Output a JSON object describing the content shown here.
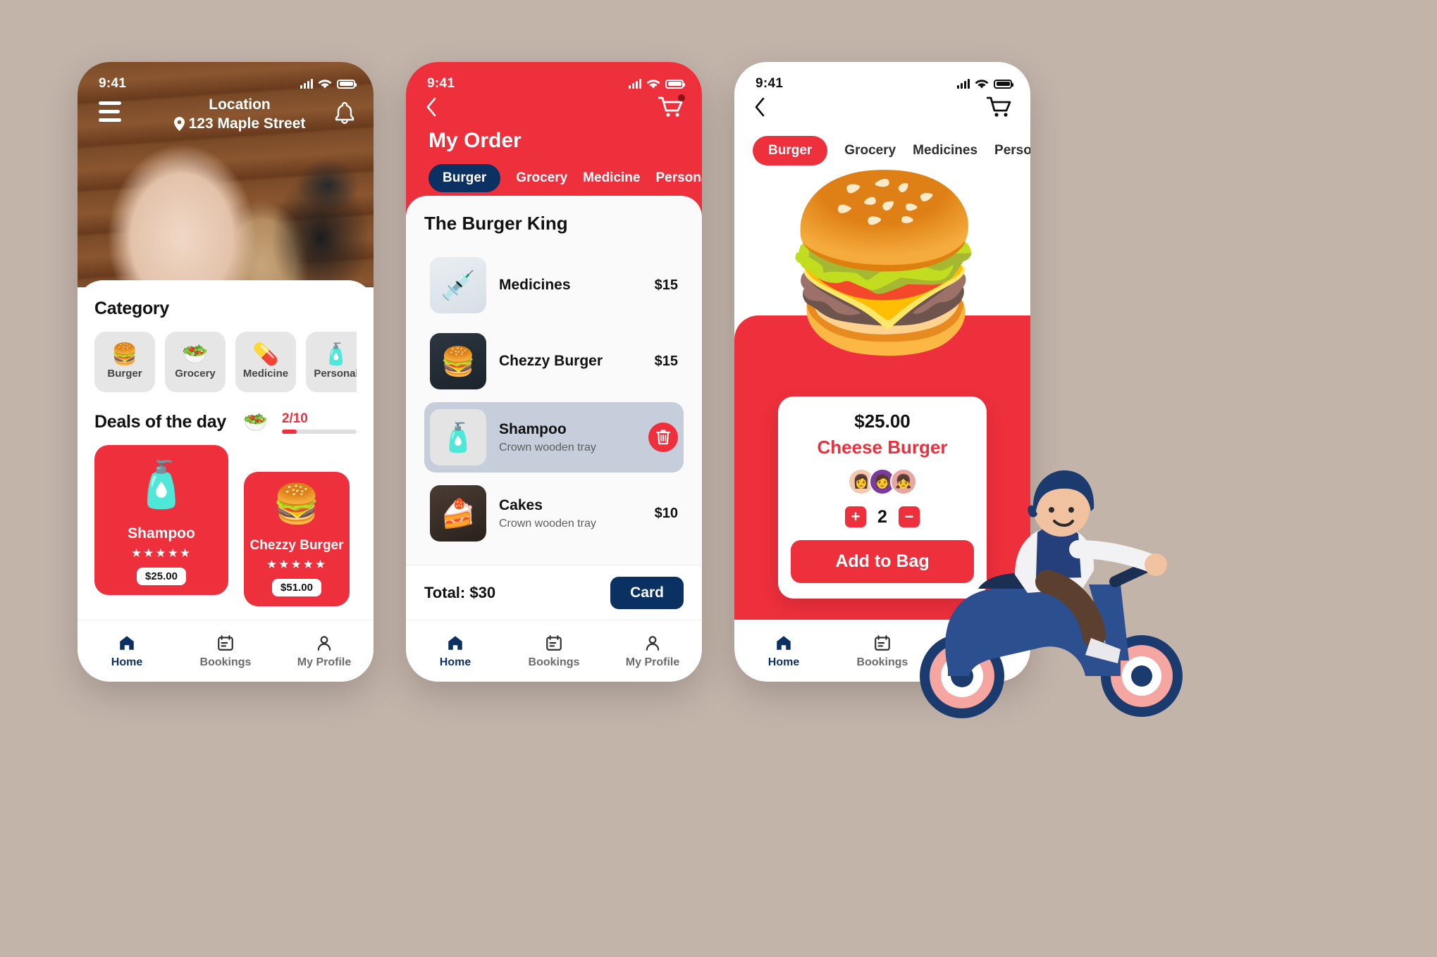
{
  "theme": {
    "brand_red": "#ee2f3c",
    "navy": "#0a3161",
    "bg": "#c3b4aa"
  },
  "phone1": {
    "status": {
      "time": "9:41"
    },
    "header": {
      "menu_icon": "hamburger-icon",
      "location_label": "Location",
      "location_address": "123 Maple Street",
      "pin_icon": "map-pin-icon",
      "bell_icon": "bell-icon"
    },
    "category": {
      "title": "Category",
      "items": [
        {
          "label": "Burger",
          "emoji": "🍔"
        },
        {
          "label": "Grocery",
          "emoji": "🥗"
        },
        {
          "label": "Medicine",
          "emoji": "💊"
        },
        {
          "label": "Personal",
          "emoji": "🧴"
        }
      ]
    },
    "deals": {
      "title": "Deals of the day",
      "emoji": "🥗",
      "counter_current": "2",
      "counter_total": "/10",
      "progress_percent": 20,
      "cards": [
        {
          "name": "Shampoo",
          "emoji": "🧴",
          "stars": "★★★★★",
          "price": "$25.00"
        },
        {
          "name": "Chezzy Burger",
          "emoji": "🍔",
          "stars": "★★★★★",
          "price": "$51.00"
        }
      ]
    },
    "tabbar": [
      {
        "label": "Home",
        "icon": "home-icon",
        "active": true
      },
      {
        "label": "Bookings",
        "icon": "calendar-icon",
        "active": false
      },
      {
        "label": "My Profile",
        "icon": "person-icon",
        "active": false
      }
    ]
  },
  "phone2": {
    "status": {
      "time": "9:41"
    },
    "nav": {
      "back_icon": "chevron-left-icon",
      "cart_icon": "shopping-cart-icon",
      "badge": true
    },
    "title": "My Order",
    "chips": [
      {
        "label": "Burger",
        "selected": true
      },
      {
        "label": "Grocery",
        "selected": false
      },
      {
        "label": "Medicine",
        "selected": false
      },
      {
        "label": "Personal Care",
        "selected": false
      }
    ],
    "shop_title": "The Burger King",
    "items": [
      {
        "name": "Medicines",
        "sub": "",
        "price": "$15",
        "emoji": "💉",
        "selected": false
      },
      {
        "name": "Chezzy Burger",
        "sub": "",
        "price": "$15",
        "emoji": "🍔",
        "selected": false
      },
      {
        "name": "Shampoo",
        "sub": "Crown wooden tray",
        "price": "",
        "emoji": "🧴",
        "selected": true,
        "delete_icon": "trash-icon"
      },
      {
        "name": "Cakes",
        "sub": "Crown wooden tray",
        "price": "$10",
        "emoji": "🍰",
        "selected": false
      }
    ],
    "total_label": "Total: $30",
    "card_button": "Card",
    "tabbar": [
      {
        "label": "Home",
        "icon": "home-icon",
        "active": true
      },
      {
        "label": "Bookings",
        "icon": "calendar-icon",
        "active": false
      },
      {
        "label": "My Profile",
        "icon": "person-icon",
        "active": false
      }
    ]
  },
  "phone3": {
    "status": {
      "time": "9:41"
    },
    "nav": {
      "back_icon": "chevron-left-icon",
      "cart_icon": "shopping-cart-icon"
    },
    "chips": [
      {
        "label": "Burger",
        "selected": true
      },
      {
        "label": "Grocery",
        "selected": false
      },
      {
        "label": "Medicines",
        "selected": false
      },
      {
        "label": "Personal",
        "selected": false
      }
    ],
    "hero_emoji": "🍔",
    "detail": {
      "price": "$25.00",
      "name": "Cheese Burger",
      "avatars": [
        "👩",
        "🧑",
        "👧"
      ],
      "qty_plus_icon": "plus-icon",
      "qty_minus_icon": "minus-icon",
      "qty_value": "2",
      "add_button": "Add to Bag"
    },
    "tabbar": [
      {
        "label": "Home",
        "icon": "home-icon",
        "active": true
      },
      {
        "label": "Bookings",
        "icon": "calendar-icon",
        "active": false
      }
    ]
  },
  "illustration": {
    "name": "delivery-scooter-rider"
  }
}
